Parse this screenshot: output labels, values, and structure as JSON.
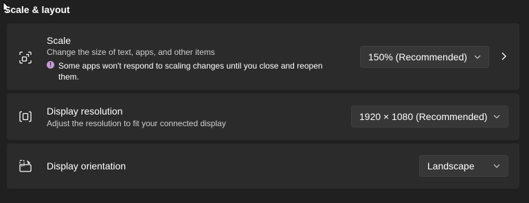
{
  "section": {
    "title": "Scale & layout"
  },
  "scale": {
    "title": "Scale",
    "description": "Change the size of text, apps, and other items",
    "warning": "Some apps won't respond to scaling changes until you close and reopen them.",
    "value": "150% (Recommended)",
    "icon": "scale-icon"
  },
  "resolution": {
    "title": "Display resolution",
    "description": "Adjust the resolution to fit your connected display",
    "value": "1920 × 1080 (Recommended)",
    "icon": "resolution-icon"
  },
  "orientation": {
    "title": "Display orientation",
    "value": "Landscape",
    "icon": "orientation-icon"
  },
  "colors": {
    "background": "#202020",
    "card": "#2b2b2b",
    "dropdown": "#373737",
    "info_accent": "#c59bd6"
  }
}
